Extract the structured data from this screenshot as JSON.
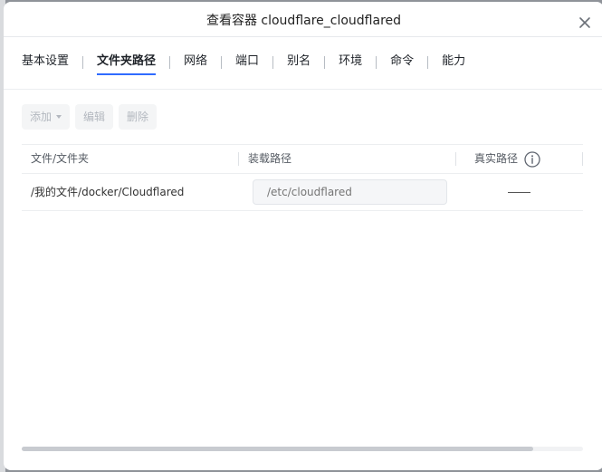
{
  "dialog": {
    "title": "查看容器 cloudflare_cloudflared"
  },
  "tabs": [
    {
      "label": "基本设置",
      "active": false
    },
    {
      "label": "文件夹路径",
      "active": true
    },
    {
      "label": "网络",
      "active": false
    },
    {
      "label": "端口",
      "active": false
    },
    {
      "label": "别名",
      "active": false
    },
    {
      "label": "环境",
      "active": false
    },
    {
      "label": "命令",
      "active": false
    },
    {
      "label": "能力",
      "active": false
    }
  ],
  "toolbar": {
    "add_label": "添加",
    "edit_label": "编辑",
    "delete_label": "删除"
  },
  "table": {
    "columns": [
      "文件/文件夹",
      "装载路径",
      "真实路径"
    ],
    "rows": [
      {
        "path": "/我的文件/docker/Cloudflared",
        "mount_path_placeholder": "/etc/cloudflared",
        "real_path": "——"
      }
    ]
  },
  "colors": {
    "accent": "#2f6bff",
    "backdrop": "#8f9399"
  },
  "icons": {
    "close": "close-icon",
    "info": "info-icon",
    "dropdown": "caret-down-icon"
  }
}
